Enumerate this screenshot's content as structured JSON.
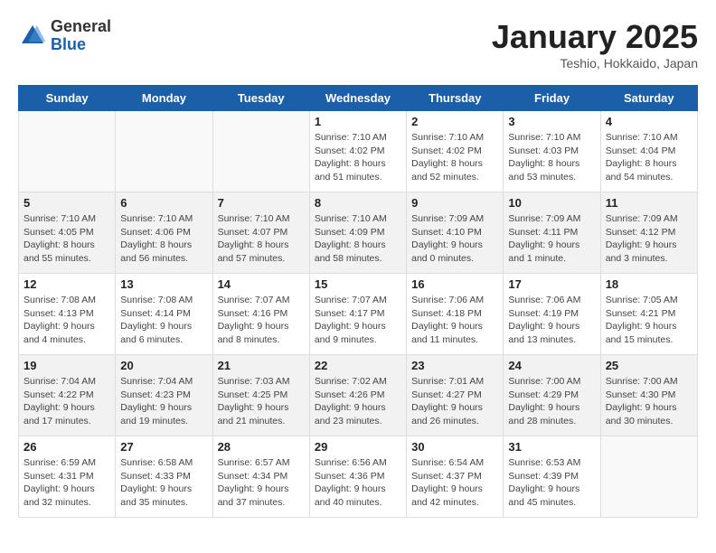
{
  "logo": {
    "general": "General",
    "blue": "Blue"
  },
  "header": {
    "month": "January 2025",
    "location": "Teshio, Hokkaido, Japan"
  },
  "weekdays": [
    "Sunday",
    "Monday",
    "Tuesday",
    "Wednesday",
    "Thursday",
    "Friday",
    "Saturday"
  ],
  "weeks": [
    [
      {
        "day": "",
        "info": ""
      },
      {
        "day": "",
        "info": ""
      },
      {
        "day": "",
        "info": ""
      },
      {
        "day": "1",
        "info": "Sunrise: 7:10 AM\nSunset: 4:02 PM\nDaylight: 8 hours\nand 51 minutes."
      },
      {
        "day": "2",
        "info": "Sunrise: 7:10 AM\nSunset: 4:02 PM\nDaylight: 8 hours\nand 52 minutes."
      },
      {
        "day": "3",
        "info": "Sunrise: 7:10 AM\nSunset: 4:03 PM\nDaylight: 8 hours\nand 53 minutes."
      },
      {
        "day": "4",
        "info": "Sunrise: 7:10 AM\nSunset: 4:04 PM\nDaylight: 8 hours\nand 54 minutes."
      }
    ],
    [
      {
        "day": "5",
        "info": "Sunrise: 7:10 AM\nSunset: 4:05 PM\nDaylight: 8 hours\nand 55 minutes."
      },
      {
        "day": "6",
        "info": "Sunrise: 7:10 AM\nSunset: 4:06 PM\nDaylight: 8 hours\nand 56 minutes."
      },
      {
        "day": "7",
        "info": "Sunrise: 7:10 AM\nSunset: 4:07 PM\nDaylight: 8 hours\nand 57 minutes."
      },
      {
        "day": "8",
        "info": "Sunrise: 7:10 AM\nSunset: 4:09 PM\nDaylight: 8 hours\nand 58 minutes."
      },
      {
        "day": "9",
        "info": "Sunrise: 7:09 AM\nSunset: 4:10 PM\nDaylight: 9 hours\nand 0 minutes."
      },
      {
        "day": "10",
        "info": "Sunrise: 7:09 AM\nSunset: 4:11 PM\nDaylight: 9 hours\nand 1 minute."
      },
      {
        "day": "11",
        "info": "Sunrise: 7:09 AM\nSunset: 4:12 PM\nDaylight: 9 hours\nand 3 minutes."
      }
    ],
    [
      {
        "day": "12",
        "info": "Sunrise: 7:08 AM\nSunset: 4:13 PM\nDaylight: 9 hours\nand 4 minutes."
      },
      {
        "day": "13",
        "info": "Sunrise: 7:08 AM\nSunset: 4:14 PM\nDaylight: 9 hours\nand 6 minutes."
      },
      {
        "day": "14",
        "info": "Sunrise: 7:07 AM\nSunset: 4:16 PM\nDaylight: 9 hours\nand 8 minutes."
      },
      {
        "day": "15",
        "info": "Sunrise: 7:07 AM\nSunset: 4:17 PM\nDaylight: 9 hours\nand 9 minutes."
      },
      {
        "day": "16",
        "info": "Sunrise: 7:06 AM\nSunset: 4:18 PM\nDaylight: 9 hours\nand 11 minutes."
      },
      {
        "day": "17",
        "info": "Sunrise: 7:06 AM\nSunset: 4:19 PM\nDaylight: 9 hours\nand 13 minutes."
      },
      {
        "day": "18",
        "info": "Sunrise: 7:05 AM\nSunset: 4:21 PM\nDaylight: 9 hours\nand 15 minutes."
      }
    ],
    [
      {
        "day": "19",
        "info": "Sunrise: 7:04 AM\nSunset: 4:22 PM\nDaylight: 9 hours\nand 17 minutes."
      },
      {
        "day": "20",
        "info": "Sunrise: 7:04 AM\nSunset: 4:23 PM\nDaylight: 9 hours\nand 19 minutes."
      },
      {
        "day": "21",
        "info": "Sunrise: 7:03 AM\nSunset: 4:25 PM\nDaylight: 9 hours\nand 21 minutes."
      },
      {
        "day": "22",
        "info": "Sunrise: 7:02 AM\nSunset: 4:26 PM\nDaylight: 9 hours\nand 23 minutes."
      },
      {
        "day": "23",
        "info": "Sunrise: 7:01 AM\nSunset: 4:27 PM\nDaylight: 9 hours\nand 26 minutes."
      },
      {
        "day": "24",
        "info": "Sunrise: 7:00 AM\nSunset: 4:29 PM\nDaylight: 9 hours\nand 28 minutes."
      },
      {
        "day": "25",
        "info": "Sunrise: 7:00 AM\nSunset: 4:30 PM\nDaylight: 9 hours\nand 30 minutes."
      }
    ],
    [
      {
        "day": "26",
        "info": "Sunrise: 6:59 AM\nSunset: 4:31 PM\nDaylight: 9 hours\nand 32 minutes."
      },
      {
        "day": "27",
        "info": "Sunrise: 6:58 AM\nSunset: 4:33 PM\nDaylight: 9 hours\nand 35 minutes."
      },
      {
        "day": "28",
        "info": "Sunrise: 6:57 AM\nSunset: 4:34 PM\nDaylight: 9 hours\nand 37 minutes."
      },
      {
        "day": "29",
        "info": "Sunrise: 6:56 AM\nSunset: 4:36 PM\nDaylight: 9 hours\nand 40 minutes."
      },
      {
        "day": "30",
        "info": "Sunrise: 6:54 AM\nSunset: 4:37 PM\nDaylight: 9 hours\nand 42 minutes."
      },
      {
        "day": "31",
        "info": "Sunrise: 6:53 AM\nSunset: 4:39 PM\nDaylight: 9 hours\nand 45 minutes."
      },
      {
        "day": "",
        "info": ""
      }
    ]
  ]
}
